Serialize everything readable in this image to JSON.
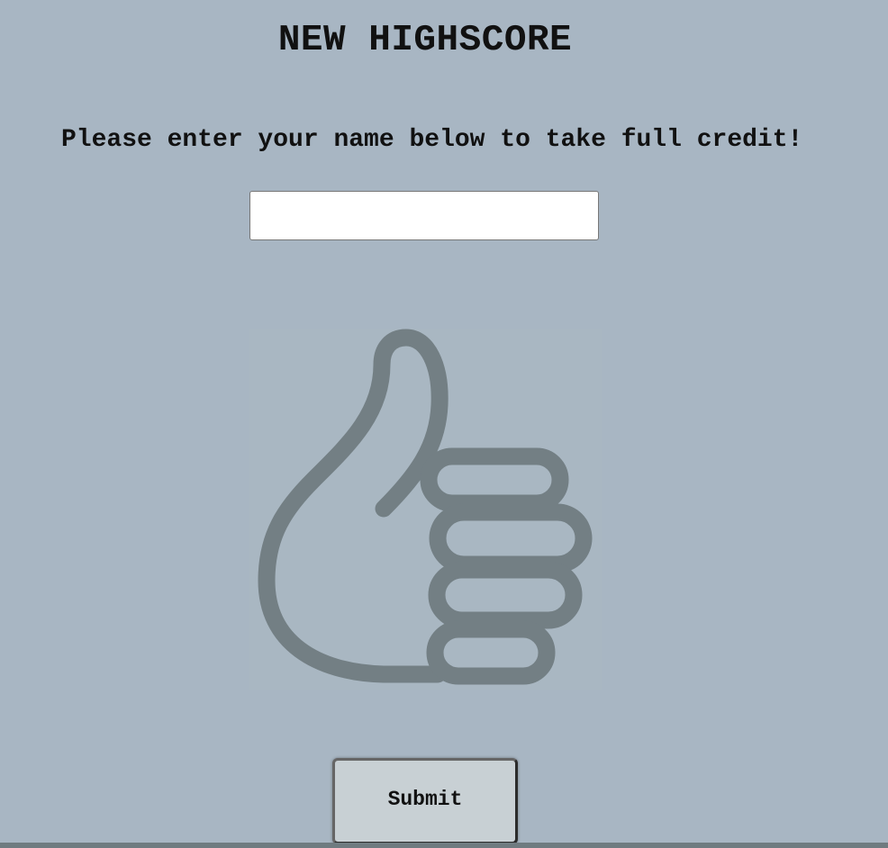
{
  "title": "NEW HIGHSCORE",
  "prompt": "Please enter your name below to take full credit!",
  "name_input": {
    "value": "",
    "placeholder": ""
  },
  "illustration": {
    "icon": "thumbs-up-icon",
    "color": "#737f84"
  },
  "submit": {
    "label": "Submit"
  },
  "colors": {
    "background": "#a8b6c3",
    "button_bg": "#c8d0d4",
    "bottom_bar": "#6f7b80"
  }
}
